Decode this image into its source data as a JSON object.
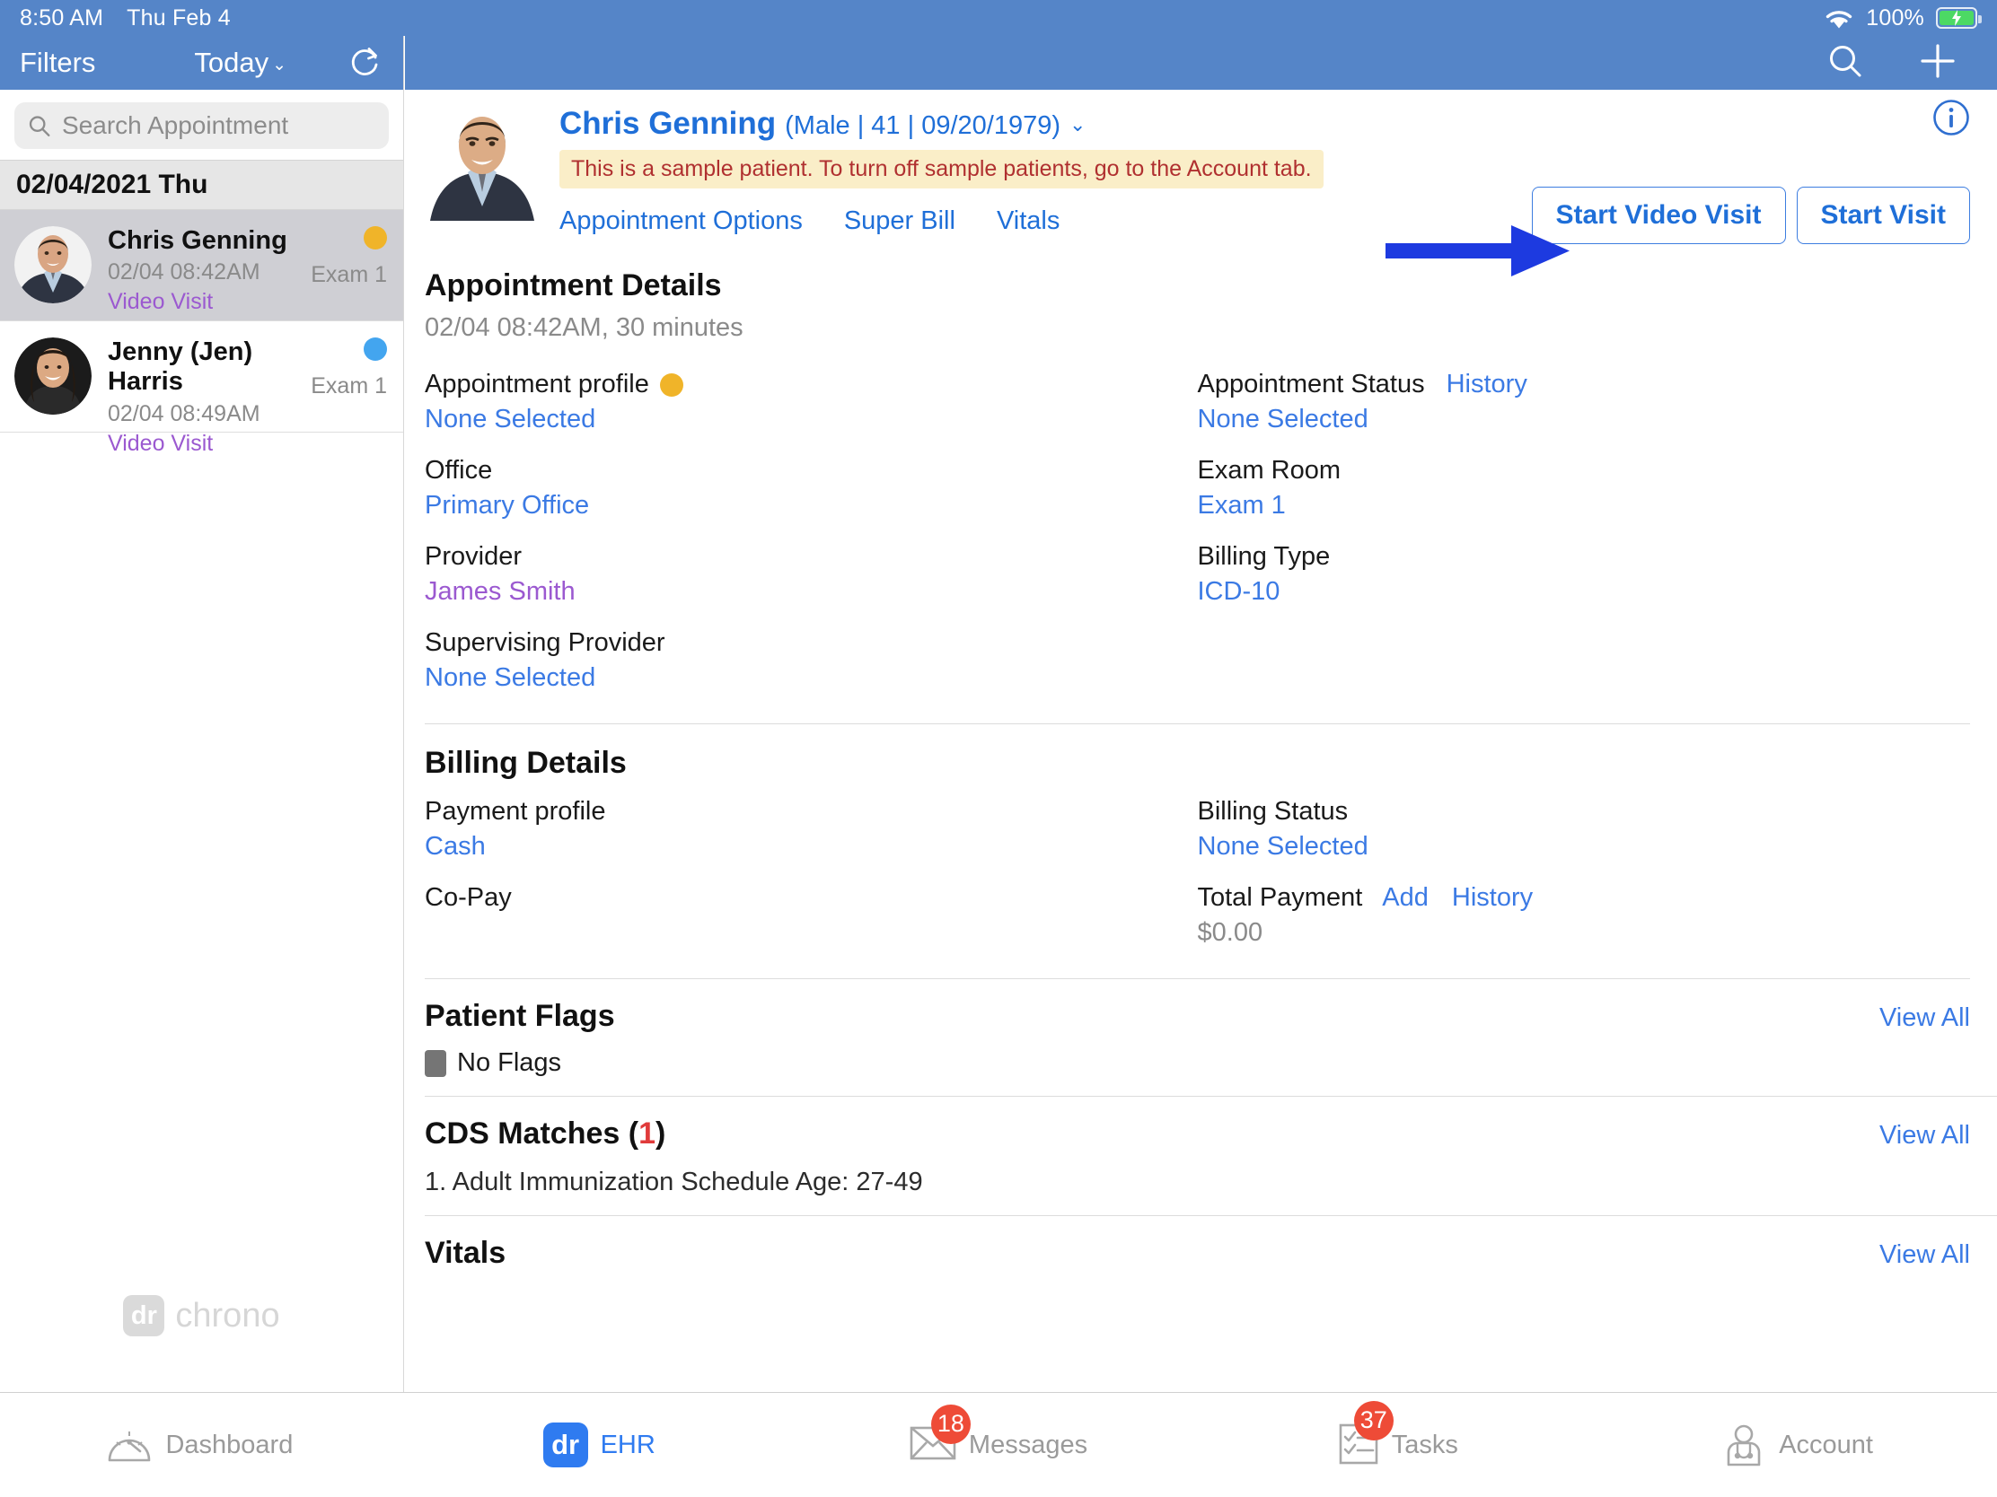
{
  "status_bar": {
    "time": "8:50 AM",
    "date": "Thu Feb 4",
    "battery_percent": "100%",
    "wifi_icon": "wifi-icon",
    "battery_icon": "battery-charging-icon"
  },
  "sidebar": {
    "filters_label": "Filters",
    "today_label": "Today",
    "refresh_icon": "refresh-icon",
    "search": {
      "placeholder": "Search Appointment",
      "value": "",
      "icon": "search-icon"
    },
    "day_header": "02/04/2021 Thu",
    "appointments": [
      {
        "name": "Chris Genning",
        "time": "02/04 08:42AM",
        "type": "Video Visit",
        "room": "Exam 1",
        "status_color": "#f0b429",
        "selected": true
      },
      {
        "name": "Jenny (Jen) Harris",
        "time": "02/04 08:49AM",
        "type": "Video Visit",
        "room": "Exam 1",
        "status_color": "#43a5ef",
        "selected": false
      }
    ],
    "watermark": {
      "badge": "dr",
      "text": "chrono"
    }
  },
  "main_header": {
    "search_icon": "search-icon",
    "add_icon": "plus-icon"
  },
  "patient": {
    "name": "Chris Genning",
    "meta": "(Male | 41 | 09/20/1979)",
    "chevron_icon": "chevron-down-icon",
    "sample_notice": "This is a sample patient. To turn off sample patients, go to the Account tab.",
    "info_icon": "info-icon",
    "links": [
      "Appointment Options",
      "Super Bill",
      "Vitals"
    ],
    "buttons": [
      {
        "label": "Start Video Visit",
        "annotated": true
      },
      {
        "label": "Start Visit",
        "annotated": false
      }
    ]
  },
  "appointment_details": {
    "title": "Appointment Details",
    "subtitle": "02/04 08:42AM, 30 minutes",
    "left_fields": [
      {
        "label": "Appointment profile",
        "value": "None Selected",
        "dot": "#f0b429"
      },
      {
        "label": "Office",
        "value": "Primary Office"
      },
      {
        "label": "Provider",
        "value": "James Smith",
        "value_style": "purple"
      },
      {
        "label": "Supervising Provider",
        "value": "None Selected"
      }
    ],
    "right_fields": [
      {
        "label": "Appointment Status",
        "link": "History",
        "value": "None Selected"
      },
      {
        "label": "Exam Room",
        "value": "Exam 1"
      },
      {
        "label": "Billing Type",
        "value": "ICD-10"
      }
    ]
  },
  "billing_details": {
    "title": "Billing Details",
    "left_fields": [
      {
        "label": "Payment profile",
        "value": "Cash"
      },
      {
        "label": "Co-Pay",
        "value": ""
      }
    ],
    "right_fields": [
      {
        "label": "Billing Status",
        "value": "None Selected"
      },
      {
        "label": "Total Payment",
        "links": [
          "Add",
          "History"
        ],
        "value": "$0.00",
        "value_style": "grey"
      }
    ]
  },
  "patient_flags": {
    "title": "Patient Flags",
    "view_all": "View All",
    "flag_text": "No Flags"
  },
  "cds_matches": {
    "title_prefix": "CDS Matches (",
    "count": "1",
    "title_suffix": ")",
    "view_all": "View All",
    "items": [
      "1. Adult Immunization Schedule Age: 27-49"
    ]
  },
  "vitals_section": {
    "title": "Vitals",
    "view_all": "View All"
  },
  "tabbar": [
    {
      "label": "Dashboard",
      "icon": "gauge-icon",
      "active": false,
      "badge": ""
    },
    {
      "label": "EHR",
      "icon": "dr-chrono-icon",
      "active": true,
      "badge": ""
    },
    {
      "label": "Messages",
      "icon": "envelope-icon",
      "active": false,
      "badge": "18"
    },
    {
      "label": "Tasks",
      "icon": "checklist-icon",
      "active": false,
      "badge": "37"
    },
    {
      "label": "Account",
      "icon": "doctor-icon",
      "active": false,
      "badge": ""
    }
  ],
  "colors": {
    "header_blue": "#5585c8",
    "link_blue": "#3b7ae4",
    "accent_purple": "#9b59d0",
    "badge_red": "#ee4b37",
    "amber": "#f0b429",
    "annotation_blue": "#1d3ae0"
  }
}
